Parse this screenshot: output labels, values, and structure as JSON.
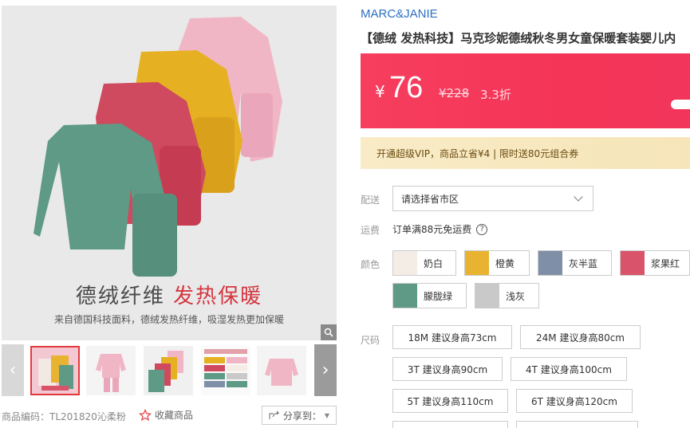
{
  "gallery": {
    "caption_main": "德绒纤维 ",
    "caption_highlight": "发热保暖",
    "caption_sub": "来自德国科技面料，德绒发热纤维，吸湿发热更加保暖",
    "sku_code": "商品编码：TL201820沁柔粉",
    "favorite_label": "收藏商品",
    "share_label": "分享到："
  },
  "product": {
    "brand": "MARC&JANIE",
    "title": "【德绒 发热科技】马克珍妮德绒秋冬男女童保暖套装婴儿内"
  },
  "price": {
    "currency": "¥",
    "current": "76",
    "original": "¥228",
    "discount": "3.3折"
  },
  "vip": {
    "text": "开通超级VIP，商品立省¥4 | 限时送80元组合券"
  },
  "shipping": {
    "label": "配送",
    "select_value": "请选择省市区",
    "freight_label": "运费",
    "freight_text": "订单满88元免运费"
  },
  "colors": {
    "label": "颜色",
    "options": [
      {
        "name": "奶白",
        "color": "#f4ede6"
      },
      {
        "name": "橙黄",
        "color": "#e8b330"
      },
      {
        "name": "灰半蓝",
        "color": "#7f8fa8"
      },
      {
        "name": "浆果红",
        "color": "#d9546a"
      },
      {
        "name": "朦胧绿",
        "color": "#5f9a86"
      },
      {
        "name": "浅灰",
        "color": "#c9c9c9"
      }
    ]
  },
  "sizes": {
    "label": "尺码",
    "options": [
      "18M 建议身高73cm",
      "24M 建议身高80cm",
      "3T 建议身高90cm",
      "4T 建议身高100cm",
      "5T 建议身高110cm",
      "6T 建议身高120cm"
    ]
  },
  "theme": {
    "price_red": "#f43558",
    "brand_blue": "#2b6fc4",
    "vip_gold": "#f7e8bf"
  }
}
